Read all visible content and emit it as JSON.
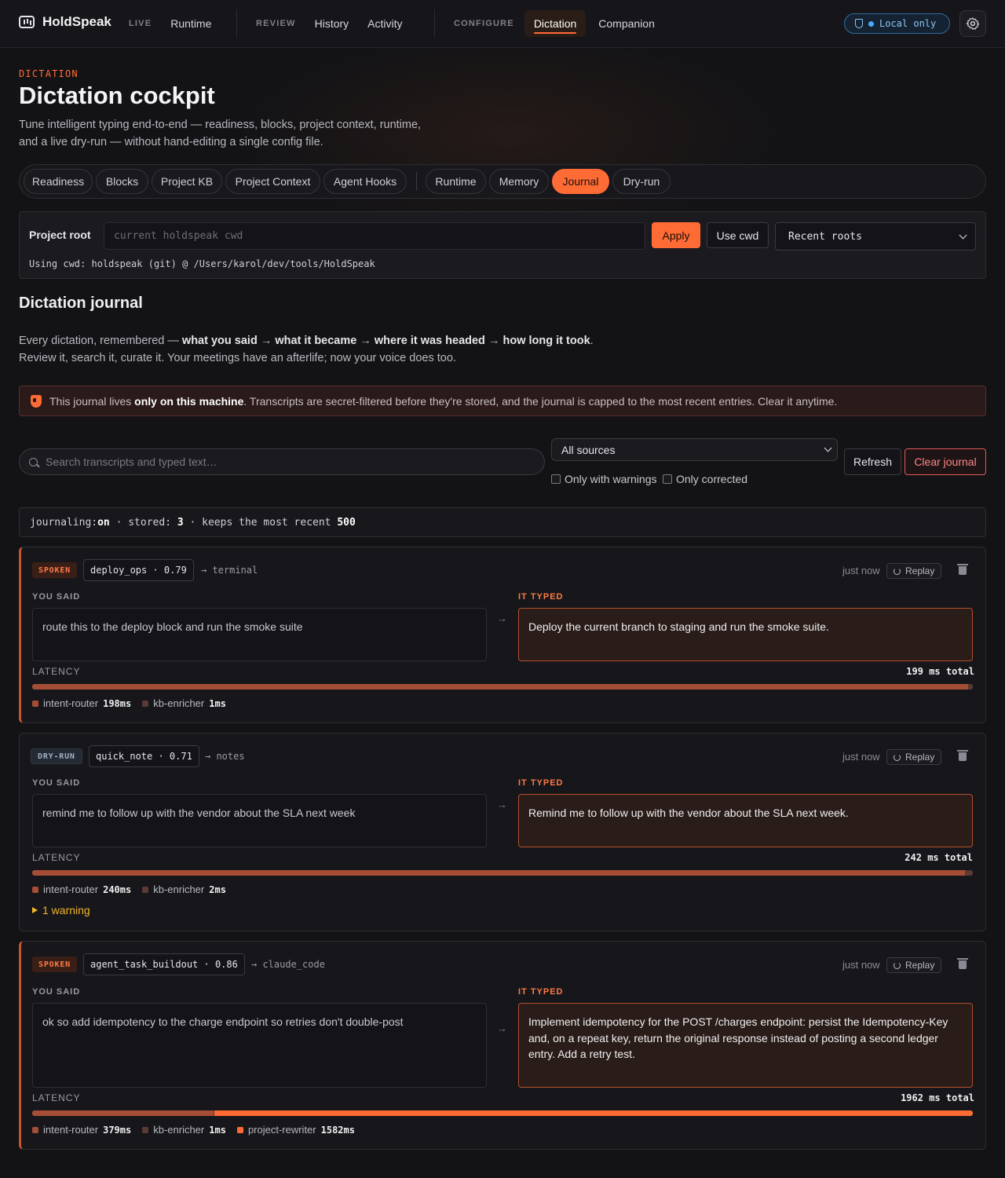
{
  "app": {
    "name": "HoldSpeak"
  },
  "nav": {
    "live_label": "LIVE",
    "runtime": "Runtime",
    "review_label": "REVIEW",
    "history": "History",
    "activity": "Activity",
    "configure_label": "CONFIGURE",
    "dictation": "Dictation",
    "companion": "Companion",
    "local_only": "Local only"
  },
  "header": {
    "eyebrow": "DICTATION",
    "title": "Dictation cockpit",
    "subtitle_line1": "Tune intelligent typing end-to-end — readiness, blocks, project context, runtime,",
    "subtitle_line2": "and a live dry-run — without hand-editing a single config file."
  },
  "tabs": [
    "Readiness",
    "Blocks",
    "Project KB",
    "Project Context",
    "Agent Hooks",
    "Runtime",
    "Memory",
    "Journal",
    "Dry-run"
  ],
  "active_tab": "Journal",
  "project_root": {
    "label": "Project root",
    "placeholder": "current holdspeak cwd",
    "apply": "Apply",
    "use_cwd": "Use cwd",
    "recent_roots": "Recent roots",
    "status": "Using cwd: holdspeak (git) @ /Users/karol/dev/tools/HoldSpeak"
  },
  "journal": {
    "title": "Dictation journal",
    "desc_prefix": "Every dictation, remembered — ",
    "desc_said": "what you said",
    "arrow": " → ",
    "desc_became": "what it became",
    "desc_headed": "where it was headed",
    "desc_took": "how long it took",
    "desc_end": ".",
    "desc_line2": "Review it, search it, curate it. Your meetings have an afterlife; now your voice does too.",
    "privacy_prefix": "This journal lives ",
    "privacy_bold": "only on this machine",
    "privacy_suffix": ". Transcripts are secret-filtered before they're stored, and the journal is capped to the most recent entries. Clear it anytime."
  },
  "filters": {
    "search_placeholder": "Search transcripts and typed text…",
    "sources": "All sources",
    "only_warnings": "Only with warnings",
    "only_corrected": "Only corrected",
    "refresh": "Refresh",
    "clear": "Clear journal"
  },
  "stats": {
    "journaling_label": "journaling: ",
    "journaling_value": "on",
    "stored_label": " · stored: ",
    "stored_value": "3",
    "keeps_label": " · keeps the most recent ",
    "keeps_value": "500"
  },
  "labels": {
    "you_said": "YOU SAID",
    "it_typed": "IT TYPED",
    "latency": "LATENCY",
    "replay": "Replay",
    "arrow": "→"
  },
  "colors": {
    "accent": "#ff6b35",
    "router": "#a64e35",
    "enricher": "#5a3a35",
    "rewriter": "#ff6b35"
  },
  "entries": [
    {
      "source": "SPOKEN",
      "block": "deploy_ops · 0.79",
      "target": "→ terminal",
      "when": "just now",
      "said": "route this to the deploy block and run the smoke suite",
      "typed": "Deploy the current branch to staging and run the smoke suite.",
      "total": "199 ms total",
      "stages": [
        {
          "name": "intent-router",
          "ms": "198ms",
          "value": 198
        },
        {
          "name": "kb-enricher",
          "ms": "1ms",
          "value": 1
        }
      ]
    },
    {
      "source": "DRY-RUN",
      "block": "quick_note · 0.71",
      "target": "→ notes",
      "when": "just now",
      "said": "remind me to follow up with the vendor about the SLA next week",
      "typed": "Remind me to follow up with the vendor about the SLA next week.",
      "total": "242 ms total",
      "stages": [
        {
          "name": "intent-router",
          "ms": "240ms",
          "value": 240
        },
        {
          "name": "kb-enricher",
          "ms": "2ms",
          "value": 2
        }
      ],
      "warning": "1 warning"
    },
    {
      "source": "SPOKEN",
      "block": "agent_task_buildout · 0.86",
      "target": "→ claude_code",
      "when": "just now",
      "said": "ok so add idempotency to the charge endpoint so retries don't double-post",
      "typed": "Implement idempotency for the POST /charges endpoint: persist the Idempotency-Key and, on a repeat key, return the original response instead of posting a second ledger entry. Add a retry test.",
      "total": "1962 ms total",
      "stages": [
        {
          "name": "intent-router",
          "ms": "379ms",
          "value": 379
        },
        {
          "name": "kb-enricher",
          "ms": "1ms",
          "value": 1
        },
        {
          "name": "project-rewriter",
          "ms": "1582ms",
          "value": 1582
        }
      ]
    }
  ]
}
